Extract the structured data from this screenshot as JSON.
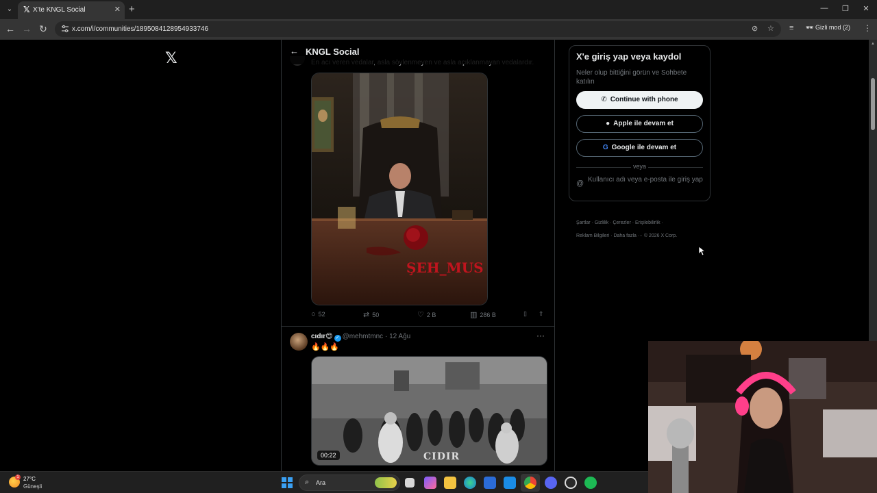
{
  "browser": {
    "tab_title": "X'te KNGL Social",
    "url": "x.com/i/communities/1895084128954933746",
    "incognito_label": "Gizli mod (2)"
  },
  "header": {
    "title": "KNGL Social"
  },
  "tweet1": {
    "cut_text": "En acı veren vedalar, asla söylenmeyen ve asla açıklanmayan vedalardır.",
    "poster_title": "ŞEH_MUS ULAŞ",
    "replies": "52",
    "reposts": "50",
    "likes": "2 B",
    "views": "286 B"
  },
  "tweet2": {
    "name": "cıdır",
    "handle": "@mehmtmnc",
    "date": "12 Ağu",
    "text": "🔥🔥🔥",
    "video_time": "00:22",
    "video_mark": "CIDIR"
  },
  "login": {
    "title": "X'e giriş yap veya kaydol",
    "subtitle": "Neler olup bittiğini görün ve Sohbete katılın",
    "phone_button": "Continue with phone",
    "apple_button": "Apple ile devam et",
    "google_button": "Google ile devam et",
    "or_text": "veya",
    "user_login": "Kullanıcı adı veya e-posta ile giriş yap"
  },
  "footer": {
    "links": [
      "Şartlar",
      "Gizlilik",
      "Çerezler",
      "Erişilebilirlik",
      "Reklam Bilgileri",
      "Daha fazla ···",
      "© 2026 X Corp."
    ]
  },
  "taskbar": {
    "temp": "27°C",
    "weather": "Güneşli",
    "search_label": "Ara"
  },
  "colors": {
    "background": "#000000",
    "button_light": "#eff3f4",
    "verified": "#1d9bf0",
    "poster_text": "#c0141e"
  }
}
